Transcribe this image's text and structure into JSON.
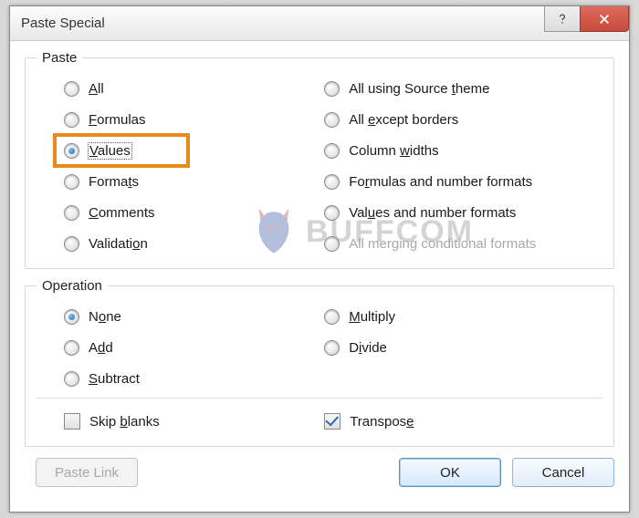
{
  "dialog": {
    "title": "Paste Special"
  },
  "paste_group": {
    "legend": "Paste",
    "left": [
      {
        "label": "All",
        "u_index": 0,
        "checked": false
      },
      {
        "label": "Formulas",
        "u_index": 0,
        "checked": false
      },
      {
        "label": "Values",
        "u_index": 0,
        "checked": true,
        "highlighted": true,
        "focused": true
      },
      {
        "label": "Formats",
        "u_index": 5,
        "checked": false
      },
      {
        "label": "Comments",
        "u_index": 0,
        "checked": false
      },
      {
        "label": "Validation",
        "u_index": 8,
        "checked": false
      }
    ],
    "right": [
      {
        "label": "All using Source theme",
        "u_index": 17,
        "checked": false
      },
      {
        "label": "All except borders",
        "u_index": 4,
        "u_word": "x",
        "checked": false
      },
      {
        "label": "Column widths",
        "u_index": 7,
        "checked": false
      },
      {
        "label": "Formulas and number formats",
        "u_index": 2,
        "u_char": "R",
        "checked": false,
        "special_pos": "front"
      },
      {
        "label": "Values and number formats",
        "u_index": 3,
        "checked": false
      },
      {
        "label": "All merging conditional formats",
        "checked": false,
        "disabled": true
      }
    ]
  },
  "operation_group": {
    "legend": "Operation",
    "left": [
      {
        "label": "None",
        "u_index": 1,
        "checked": true
      },
      {
        "label": "Add",
        "u_index": 1,
        "checked": false
      },
      {
        "label": "Subtract",
        "u_index": 0,
        "checked": false
      }
    ],
    "right": [
      {
        "label": "Multiply",
        "u_index": 0,
        "checked": false
      },
      {
        "label": "Divide",
        "u_index": 1,
        "checked": false
      }
    ]
  },
  "options": {
    "skip_blanks": {
      "label": "Skip blanks",
      "u_index": 5,
      "checked": false
    },
    "transpose": {
      "label": "Transpose",
      "u_index": 8,
      "checked": true
    }
  },
  "buttons": {
    "paste_link": "Paste Link",
    "ok": "OK",
    "cancel": "Cancel"
  },
  "watermark": "BUFFCOM"
}
